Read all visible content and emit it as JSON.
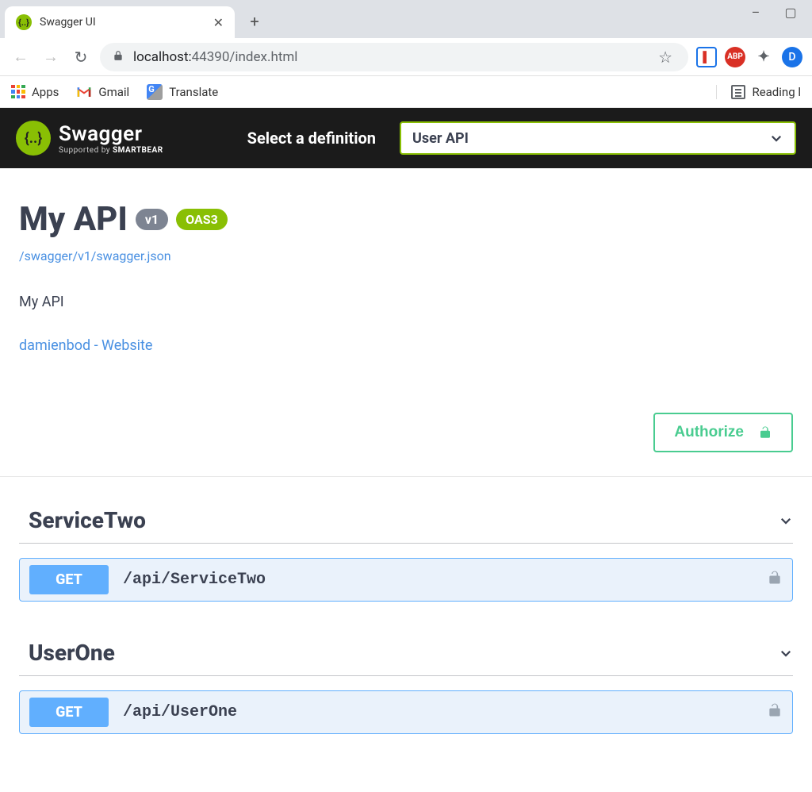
{
  "browser": {
    "tab_title": "Swagger UI",
    "url_host": "localhost:",
    "url_port_path": "44390/index.html",
    "window_controls": {
      "minimize": "–",
      "maximize": "▢"
    },
    "profile_letter": "D",
    "ext_abp": "ABP"
  },
  "bookmarks": {
    "items": [
      {
        "label": "Apps"
      },
      {
        "label": "Gmail"
      },
      {
        "label": "Translate"
      }
    ],
    "reading_list": "Reading l"
  },
  "topbar": {
    "brand": "Swagger",
    "supported_prefix": "Supported by ",
    "supported_brand": "SMARTBEAR",
    "select_label": "Select a definition",
    "selected_definition": "User API"
  },
  "info": {
    "title": "My API",
    "version": "v1",
    "oas": "OAS3",
    "spec_link": "/swagger/v1/swagger.json",
    "description": "My API",
    "contact": "damienbod - Website"
  },
  "auth": {
    "button": "Authorize"
  },
  "tags": [
    {
      "name": "ServiceTwo",
      "operations": [
        {
          "method": "GET",
          "path": "/api/ServiceTwo"
        }
      ]
    },
    {
      "name": "UserOne",
      "operations": [
        {
          "method": "GET",
          "path": "/api/UserOne"
        }
      ]
    }
  ]
}
